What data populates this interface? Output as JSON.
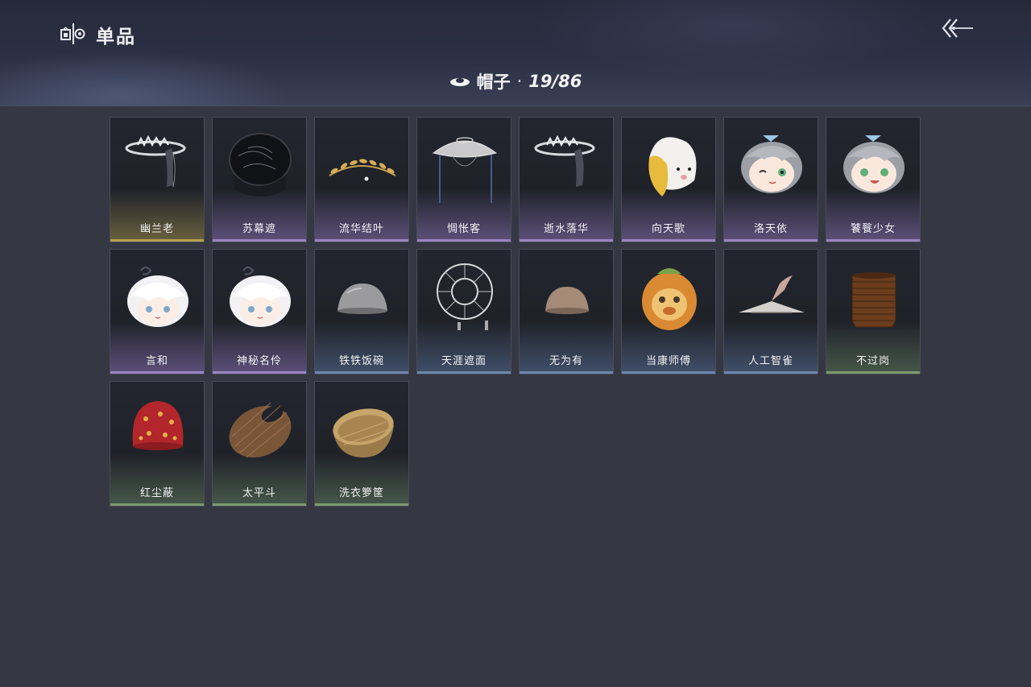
{
  "app": {
    "title": "单品",
    "icon": "wardrobe-icon"
  },
  "back_button": {
    "icon": "back-arrow-icon"
  },
  "category": {
    "icon": "hat-icon",
    "label": "帽子",
    "separator": "·",
    "count": "19/86"
  },
  "items": [
    {
      "name": "幽兰老",
      "rarity": "gold",
      "icon": "silver-veil-crown-icon"
    },
    {
      "name": "苏幕遮",
      "rarity": "purple",
      "icon": "black-veil-hat-icon"
    },
    {
      "name": "流华结叶",
      "rarity": "purple",
      "icon": "golden-leaf-circlet-icon"
    },
    {
      "name": "惆怅客",
      "rarity": "purple",
      "icon": "conical-straw-hat-icon"
    },
    {
      "name": "逝水落华",
      "rarity": "purple",
      "icon": "silver-veil-crown-icon"
    },
    {
      "name": "向天歌",
      "rarity": "purple",
      "icon": "goose-hood-icon"
    },
    {
      "name": "洛天依",
      "rarity": "purple",
      "icon": "chibi-grey-hair-winking-icon"
    },
    {
      "name": "饕餮少女",
      "rarity": "purple",
      "icon": "chibi-grey-hair-smiling-icon"
    },
    {
      "name": "言和",
      "rarity": "purple",
      "icon": "chibi-white-hair-icon"
    },
    {
      "name": "神秘名伶",
      "rarity": "purple",
      "icon": "chibi-white-hair-icon"
    },
    {
      "name": "铁铁饭碗",
      "rarity": "blue",
      "icon": "iron-bowl-icon"
    },
    {
      "name": "天涯遮面",
      "rarity": "blue",
      "icon": "frame-hat-icon"
    },
    {
      "name": "无为有",
      "rarity": "blue",
      "icon": "clay-bowl-icon"
    },
    {
      "name": "当康师傅",
      "rarity": "blue",
      "icon": "orange-mask-icon"
    },
    {
      "name": "人工智雀",
      "rarity": "blue",
      "icon": "bird-hat-icon"
    },
    {
      "name": "不过岗",
      "rarity": "green",
      "icon": "stacked-bowls-icon"
    },
    {
      "name": "红尘蔽",
      "rarity": "green",
      "icon": "red-cloth-hood-icon"
    },
    {
      "name": "太平斗",
      "rarity": "green",
      "icon": "woven-bamboo-hat-icon"
    },
    {
      "name": "洗衣箩筐",
      "rarity": "green",
      "icon": "laundry-basket-icon"
    }
  ]
}
